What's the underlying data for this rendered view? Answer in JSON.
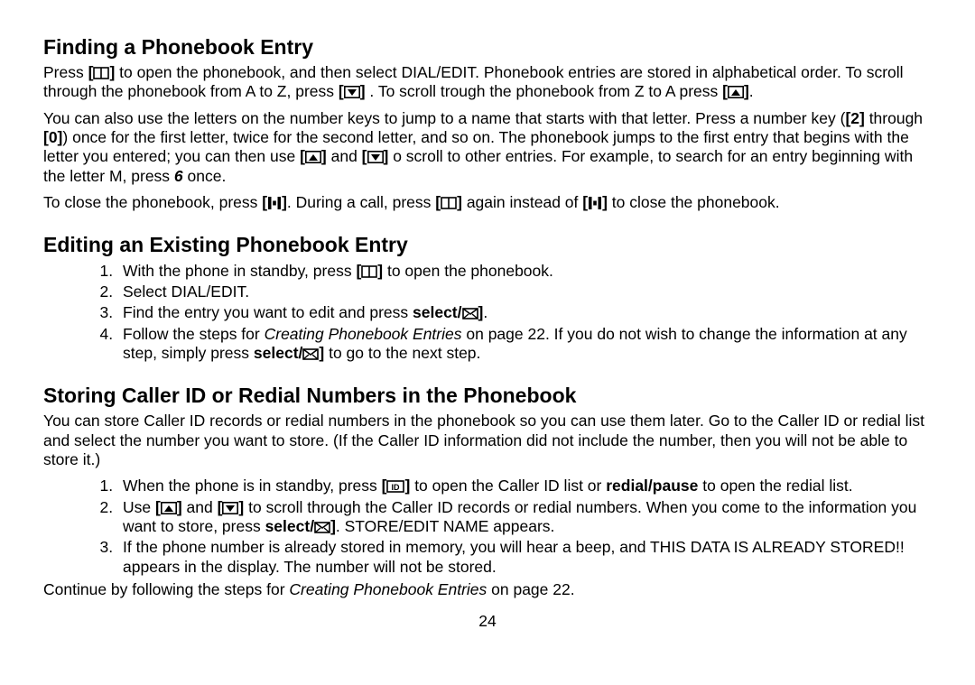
{
  "sections": {
    "finding": {
      "title": "Finding a Phonebook Entry",
      "p1a": "Press ",
      "p1b": " to open the phonebook, and then select DIAL/EDIT. Phonebook entries are stored in alphabetical order. To scroll through the phonebook from A to Z, press ",
      "p1c": ". To scroll trough the phonebook from Z to A press ",
      "p1d": ".",
      "p2a": "You can also use the letters on the number keys to jump to a name that starts with that letter. Press a number key (",
      "p2b": "[2]",
      "p2c": " through ",
      "p2d": "[0]",
      "p2e": ") once for the first letter, twice for the second letter, and so on. The phonebook jumps to the first entry that begins with the letter you entered; you can then use ",
      "p2f": " and ",
      "p2g": " o scroll to other entries. For example, to search for an entry beginning with the letter M, press ",
      "p2h": "6",
      "p2i": " once.",
      "p3a": "To close the phonebook, press ",
      "p3b": ". During a call, press ",
      "p3c": " again instead of ",
      "p3d": " to close the phonebook."
    },
    "editing": {
      "title": "Editing an Existing Phonebook Entry",
      "li1a": "With the phone in standby, press ",
      "li1b": "  to open the phonebook.",
      "li2": "Select DIAL/EDIT.",
      "li3a": "Find the entry you want to edit and press ",
      "li3b": "select/",
      "li3c": ".",
      "li4a": "Follow the steps for ",
      "li4b": "Creating Phonebook Entries",
      "li4c": " on page 22. If you do not wish to change the information at any step, simply press ",
      "li4d": "select/",
      "li4e": " to go to the next step."
    },
    "storing": {
      "title": "Storing Caller ID or Redial Numbers in the Phonebook",
      "p1": "You can store Caller ID records or redial numbers in the phonebook so you can use them later. Go to the Caller ID or redial list and select the number you want to store. (If the Caller ID information did not include the number, then you will not be able to store it.)",
      "li1a": "When the phone is in standby, press ",
      "li1b": " to open the Caller ID list or ",
      "li1c": "redial/pause",
      "li1d": " to open the redial list.",
      "li2a": "Use ",
      "li2b": " and ",
      "li2c": "  to scroll through the Caller ID records or redial numbers. When you come to the information you want to store, press ",
      "li2d": "select/",
      "li2e": ". STORE/EDIT NAME appears.",
      "li3": "If the phone number is already stored in memory, you will hear a beep, and THIS DATA IS ALREADY STORED!! appears in the display. The number will not be stored.",
      "p2a": "Continue by following the steps for ",
      "p2b": "Creating Phonebook Entries",
      "p2c": " on page 22."
    }
  },
  "page_number": "24",
  "icons": {
    "book": "book-icon",
    "down": "down-triangle-icon",
    "up": "up-triangle-icon",
    "end": "end-call-icon",
    "envelope": "envelope-icon",
    "cid": "caller-id-icon"
  }
}
